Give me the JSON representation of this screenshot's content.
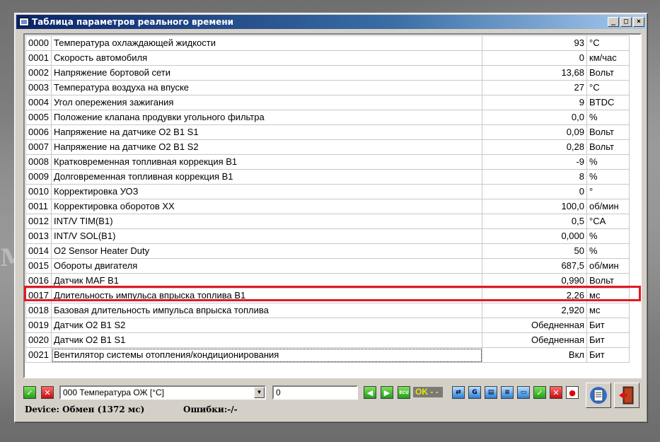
{
  "window": {
    "title": "Таблица параметров реального времени"
  },
  "window_controls": {
    "minimize": "_",
    "maximize": "□",
    "close": "×"
  },
  "background_mark": "M",
  "params": [
    {
      "id": "0000",
      "name": "Температура охлаждающей жидкости",
      "value": "93",
      "unit": "°C"
    },
    {
      "id": "0001",
      "name": "Скорость автомобиля",
      "value": "0",
      "unit": "км/час"
    },
    {
      "id": "0002",
      "name": "Напряжение бортовой сети",
      "value": "13,68",
      "unit": "Вольт"
    },
    {
      "id": "0003",
      "name": "Температура воздуха на впуске",
      "value": "27",
      "unit": "°C"
    },
    {
      "id": "0004",
      "name": "Угол опережения зажигания",
      "value": "9",
      "unit": "BTDC"
    },
    {
      "id": "0005",
      "name": "Положение клапана продувки угольного фильтра",
      "value": "0,0",
      "unit": "%"
    },
    {
      "id": "0006",
      "name": "Напряжение на датчике O2 B1 S1",
      "value": "0,09",
      "unit": "Вольт"
    },
    {
      "id": "0007",
      "name": "Напряжение на датчике O2 B1 S2",
      "value": "0,28",
      "unit": "Вольт"
    },
    {
      "id": "0008",
      "name": "Кратковременная топливная коррекция B1",
      "value": "-9",
      "unit": "%"
    },
    {
      "id": "0009",
      "name": "Долговременная топливная коррекция B1",
      "value": "8",
      "unit": "%"
    },
    {
      "id": "0010",
      "name": "Корректировка УОЗ",
      "value": "0",
      "unit": "°"
    },
    {
      "id": "0011",
      "name": "Корректировка оборотов XX",
      "value": "100,0",
      "unit": "об/мин"
    },
    {
      "id": "0012",
      "name": "INT/V TIM(B1)",
      "value": "0,5",
      "unit": "°CA"
    },
    {
      "id": "0013",
      "name": "INT/V SOL(B1)",
      "value": "0,000",
      "unit": "%"
    },
    {
      "id": "0014",
      "name": "O2 Sensor Heater Duty",
      "value": "50",
      "unit": "%"
    },
    {
      "id": "0015",
      "name": "Обороты двигателя",
      "value": "687,5",
      "unit": "об/мин"
    },
    {
      "id": "0016",
      "name": "Датчик MAF B1",
      "value": "0,990",
      "unit": "Вольт"
    },
    {
      "id": "0017",
      "name": "Длительность импульса впрыска топлива B1",
      "value": "2,26",
      "unit": "мс"
    },
    {
      "id": "0018",
      "name": "Базовая длительность импульса впрыска топлива",
      "value": "2,920",
      "unit": "мс"
    },
    {
      "id": "0019",
      "name": "Датчик O2 B1 S2",
      "value": "Обедненная",
      "unit": "Бит"
    },
    {
      "id": "0020",
      "name": "Датчик O2 B1 S1",
      "value": "Обедненная",
      "unit": "Бит"
    },
    {
      "id": "0021",
      "name": "Вентилятор системы отопления/кондиционирования",
      "value": "Вкл",
      "unit": "Бит"
    }
  ],
  "highlighted_row_id": "0016",
  "toolbar": {
    "param_select_value": "000 Температура ОЖ [°C]",
    "value_input": "0",
    "ok_indicator": "OK - -",
    "ecu_label": "ECU",
    "accent_colors": {
      "green": "#23a019",
      "red": "#c40d0d",
      "highlight": "#e11a22"
    },
    "icons": [
      "check-icon",
      "cross-icon",
      "play-left-icon",
      "play-right-icon",
      "ecu-icon",
      "link-icon",
      "g-icon",
      "db-icon",
      "list-icon",
      "monitor-icon",
      "check-icon",
      "cross-icon",
      "record-icon",
      "doc-icon",
      "exit-door-icon"
    ]
  },
  "status": {
    "device": "Device: Обмен (1372 мс)",
    "errors": "Ошибки:-/-"
  }
}
